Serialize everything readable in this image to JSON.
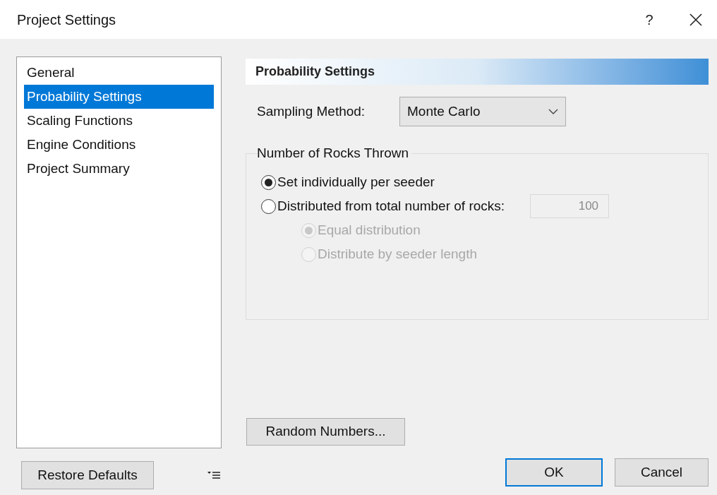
{
  "window": {
    "title": "Project Settings",
    "help": "?"
  },
  "nav": [
    {
      "label": "General",
      "selected": false
    },
    {
      "label": "Probability Settings",
      "selected": true
    },
    {
      "label": "Scaling Functions",
      "selected": false
    },
    {
      "label": "Engine Conditions",
      "selected": false
    },
    {
      "label": "Project Summary",
      "selected": false
    }
  ],
  "panel": {
    "header": "Probability Settings",
    "sampling": {
      "label": "Sampling Method:",
      "value": "Monte Carlo"
    },
    "group": {
      "title": "Number of Rocks Thrown",
      "options": [
        {
          "label": "Set individually per seeder",
          "selected": true,
          "disabled": false
        },
        {
          "label": "Distributed from total number of rocks:",
          "selected": false,
          "disabled": false,
          "field": {
            "value": "100",
            "disabled": true
          },
          "children": [
            {
              "label": "Equal distribution",
              "selected": true,
              "disabled": true
            },
            {
              "label": "Distribute by seeder length",
              "selected": false,
              "disabled": true
            }
          ]
        }
      ]
    },
    "random_button": "Random Numbers..."
  },
  "footer": {
    "restore_button": "Restore Defaults",
    "ok_button": "OK",
    "cancel_button": "Cancel"
  }
}
